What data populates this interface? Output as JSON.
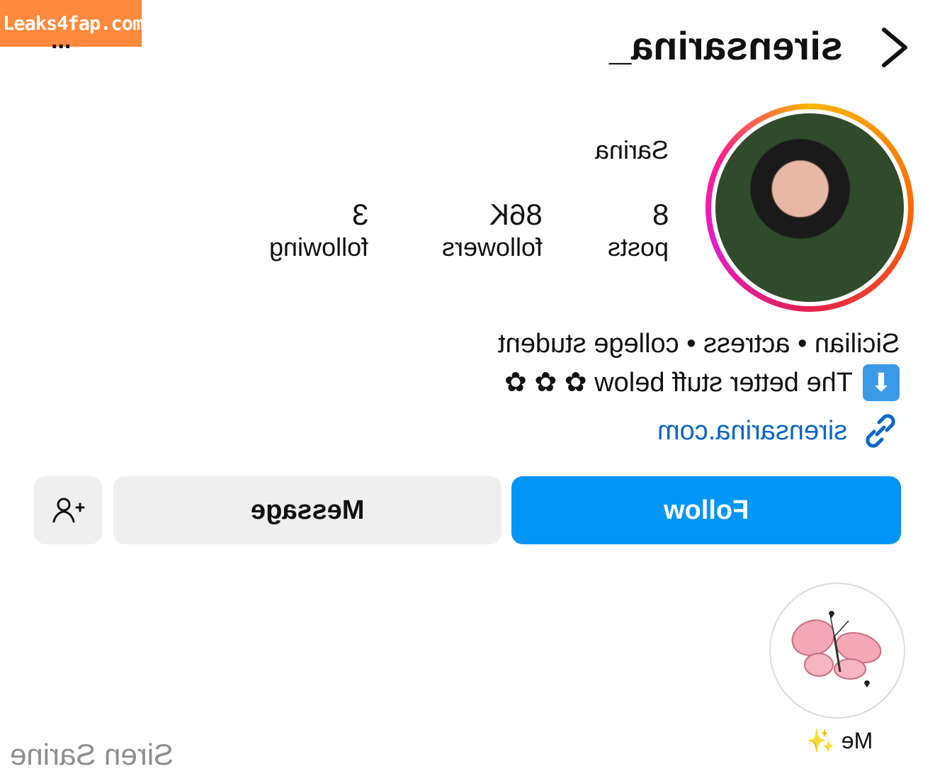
{
  "watermark": {
    "text": "Leaks4fap.com"
  },
  "header": {
    "username": "sirensarina_",
    "more_label": "..."
  },
  "profile": {
    "display_name": "Sarina",
    "stats": [
      {
        "value": "8",
        "label": "posts"
      },
      {
        "value": "86K",
        "label": "followers"
      },
      {
        "value": "3",
        "label": "following"
      }
    ],
    "bio": {
      "line1": "Sicilian • actress • college student",
      "line2_arrow": "⬇",
      "line2": "The better stuff below ✿ ✿ ✿",
      "link": "sirensarina.com"
    }
  },
  "actions": {
    "follow_label": "Follow",
    "message_label": "Message"
  },
  "highlights": [
    {
      "label": "Me ✨"
    }
  ],
  "footer": {
    "name": "Siren Sarine"
  },
  "colors": {
    "accent": "#0095f6",
    "button_gray": "#efefef",
    "link": "#0a66c8",
    "watermark": "#ff8a3d"
  },
  "icons": [
    "chevron-icon",
    "more-icon",
    "link-icon",
    "add-user-icon",
    "butterfly-icon"
  ]
}
